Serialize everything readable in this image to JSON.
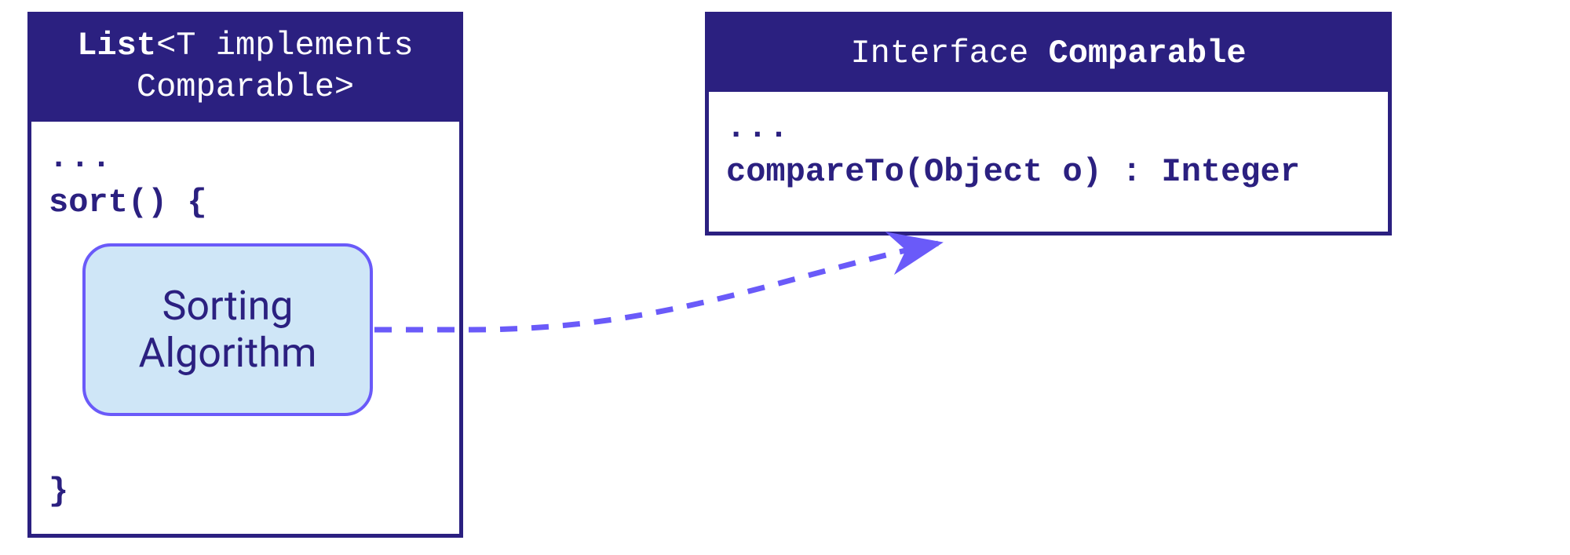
{
  "left_box": {
    "header_line1_bold": "List",
    "header_line1_plain": "<T implements",
    "header_line2_plain": "Comparable>",
    "body_dots": "...",
    "body_method": "sort() {",
    "body_close": "}",
    "inner_label_line1": "Sorting",
    "inner_label_line2": "Algorithm"
  },
  "right_box": {
    "header_plain": "Interface",
    "header_bold": "Comparable",
    "body_dots": "...",
    "body_method": "compareTo(Object o) : Integer"
  },
  "colors": {
    "box_border": "#2b2080",
    "header_bg": "#2b2080",
    "connector": "#6a5af9",
    "rounded_fill": "#cfe6f7"
  }
}
